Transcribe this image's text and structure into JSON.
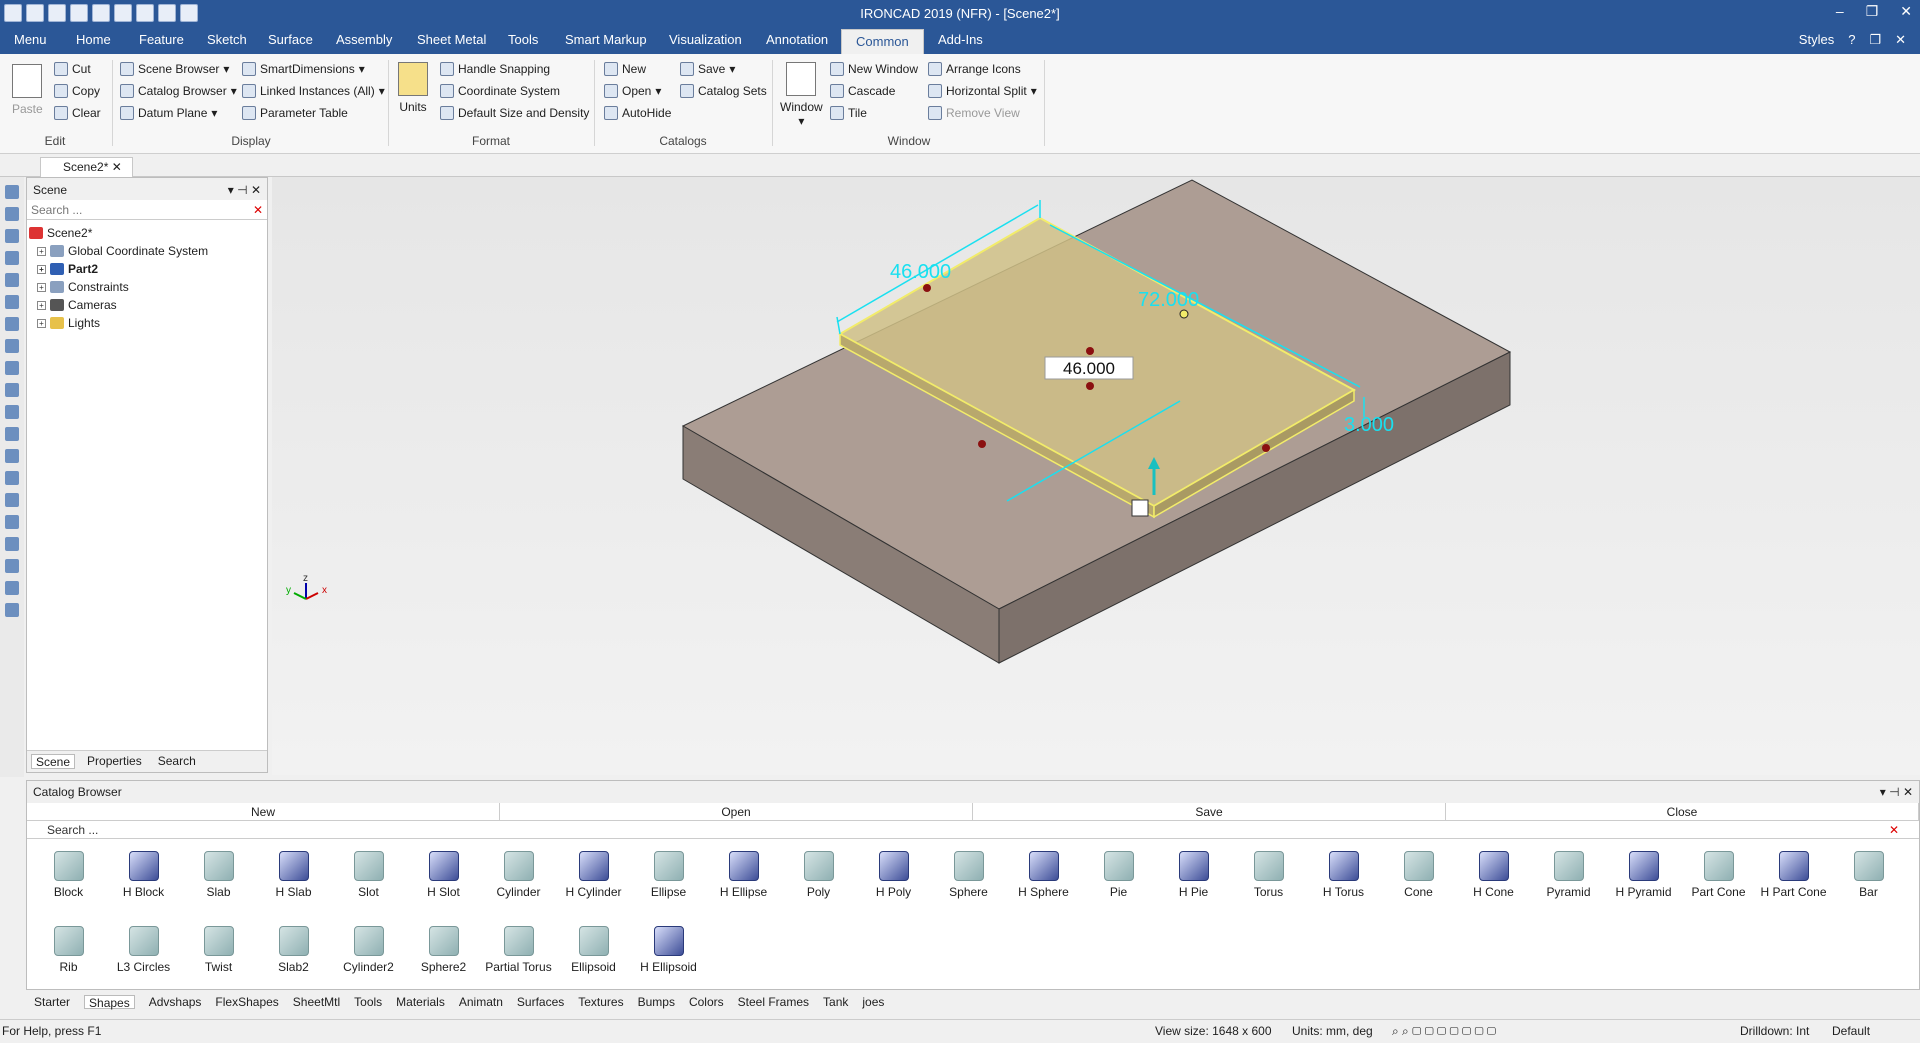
{
  "app": {
    "title": "IRONCAD 2019 (NFR) - [Scene2*]"
  },
  "menu": {
    "tabs": [
      "Menu",
      "Home",
      "Feature",
      "Sketch",
      "Surface",
      "Assembly",
      "Sheet Metal",
      "Tools",
      "Smart Markup",
      "Visualization",
      "Annotation",
      "Common",
      "Add-Ins"
    ],
    "active": "Common",
    "styles": "Styles"
  },
  "ribbon": {
    "edit": {
      "paste": "Paste",
      "cut": "Cut",
      "copy": "Copy",
      "clear": "Clear",
      "label": "Edit"
    },
    "display": {
      "scene_browser": "Scene Browser",
      "catalog_browser": "Catalog Browser",
      "datum_plane": "Datum Plane",
      "smart_dimensions": "SmartDimensions",
      "linked_instances": "Linked Instances (All)",
      "parameter_table": "Parameter Table",
      "label": "Display"
    },
    "format": {
      "units": "Units",
      "handle_snapping": "Handle Snapping",
      "coordinate_system": "Coordinate System",
      "default_size": "Default Size and Density",
      "label": "Format"
    },
    "catalogs": {
      "new": "New",
      "open": "Open",
      "autohide": "AutoHide",
      "save": "Save",
      "catalog_sets": "Catalog Sets",
      "label": "Catalogs"
    },
    "window": {
      "window": "Window",
      "new_window": "New Window",
      "cascade": "Cascade",
      "tile": "Tile",
      "arrange_icons": "Arrange Icons",
      "horizontal_split": "Horizontal Split",
      "remove_view": "Remove View",
      "label": "Window"
    }
  },
  "doc_tab": "Scene2*",
  "scene_panel": {
    "title": "Scene",
    "search_placeholder": "Search ...",
    "root": "Scene2*",
    "items": [
      "Global Coordinate System",
      "Part2",
      "Constraints",
      "Cameras",
      "Lights"
    ],
    "tabs": [
      "Scene",
      "Properties",
      "Search"
    ]
  },
  "viewport": {
    "dims": {
      "d1": "46.000",
      "d2": "72.000",
      "d3": "3.000",
      "edit": "46.000"
    },
    "axes": {
      "z": "z",
      "x": "x",
      "y": "y"
    }
  },
  "catalog": {
    "title": "Catalog Browser",
    "buttons": [
      "New",
      "Open",
      "Save",
      "Close"
    ],
    "search_placeholder": "Search ...",
    "shapes": [
      {
        "n": "Block",
        "h": false
      },
      {
        "n": "H Block",
        "h": true
      },
      {
        "n": "Slab",
        "h": false
      },
      {
        "n": "H Slab",
        "h": true
      },
      {
        "n": "Slot",
        "h": false
      },
      {
        "n": "H Slot",
        "h": true
      },
      {
        "n": "Cylinder",
        "h": false
      },
      {
        "n": "H Cylinder",
        "h": true
      },
      {
        "n": "Ellipse",
        "h": false
      },
      {
        "n": "H Ellipse",
        "h": true
      },
      {
        "n": "Poly",
        "h": false
      },
      {
        "n": "H Poly",
        "h": true
      },
      {
        "n": "Sphere",
        "h": false
      },
      {
        "n": "H Sphere",
        "h": true
      },
      {
        "n": "Pie",
        "h": false
      },
      {
        "n": "H Pie",
        "h": true
      },
      {
        "n": "Torus",
        "h": false
      },
      {
        "n": "H Torus",
        "h": true
      },
      {
        "n": "Cone",
        "h": false
      },
      {
        "n": "H Cone",
        "h": true
      },
      {
        "n": "Pyramid",
        "h": false
      },
      {
        "n": "H Pyramid",
        "h": true
      },
      {
        "n": "Part Cone",
        "h": false
      },
      {
        "n": "H Part Cone",
        "h": true
      },
      {
        "n": "Bar",
        "h": false
      },
      {
        "n": "Rib",
        "h": false
      },
      {
        "n": "L3 Circles",
        "h": false
      },
      {
        "n": "Twist",
        "h": false
      },
      {
        "n": "Slab2",
        "h": false
      },
      {
        "n": "Cylinder2",
        "h": false
      },
      {
        "n": "Sphere2",
        "h": false
      },
      {
        "n": "Partial Torus",
        "h": false
      },
      {
        "n": "Ellipsoid",
        "h": false
      },
      {
        "n": "H Ellipsoid",
        "h": true
      }
    ],
    "tabs": [
      "Starter",
      "Shapes",
      "Advshaps",
      "FlexShapes",
      "SheetMtl",
      "Tools",
      "Materials",
      "Animatn",
      "Surfaces",
      "Textures",
      "Bumps",
      "Colors",
      "Steel Frames",
      "Tank",
      "joes"
    ],
    "active_tab": "Shapes"
  },
  "status": {
    "help": "For Help, press F1",
    "view_size": "View size: 1648 x  600",
    "units": "Units: mm, deg",
    "drilldown": "Drilldown: Int",
    "default": "Default"
  }
}
